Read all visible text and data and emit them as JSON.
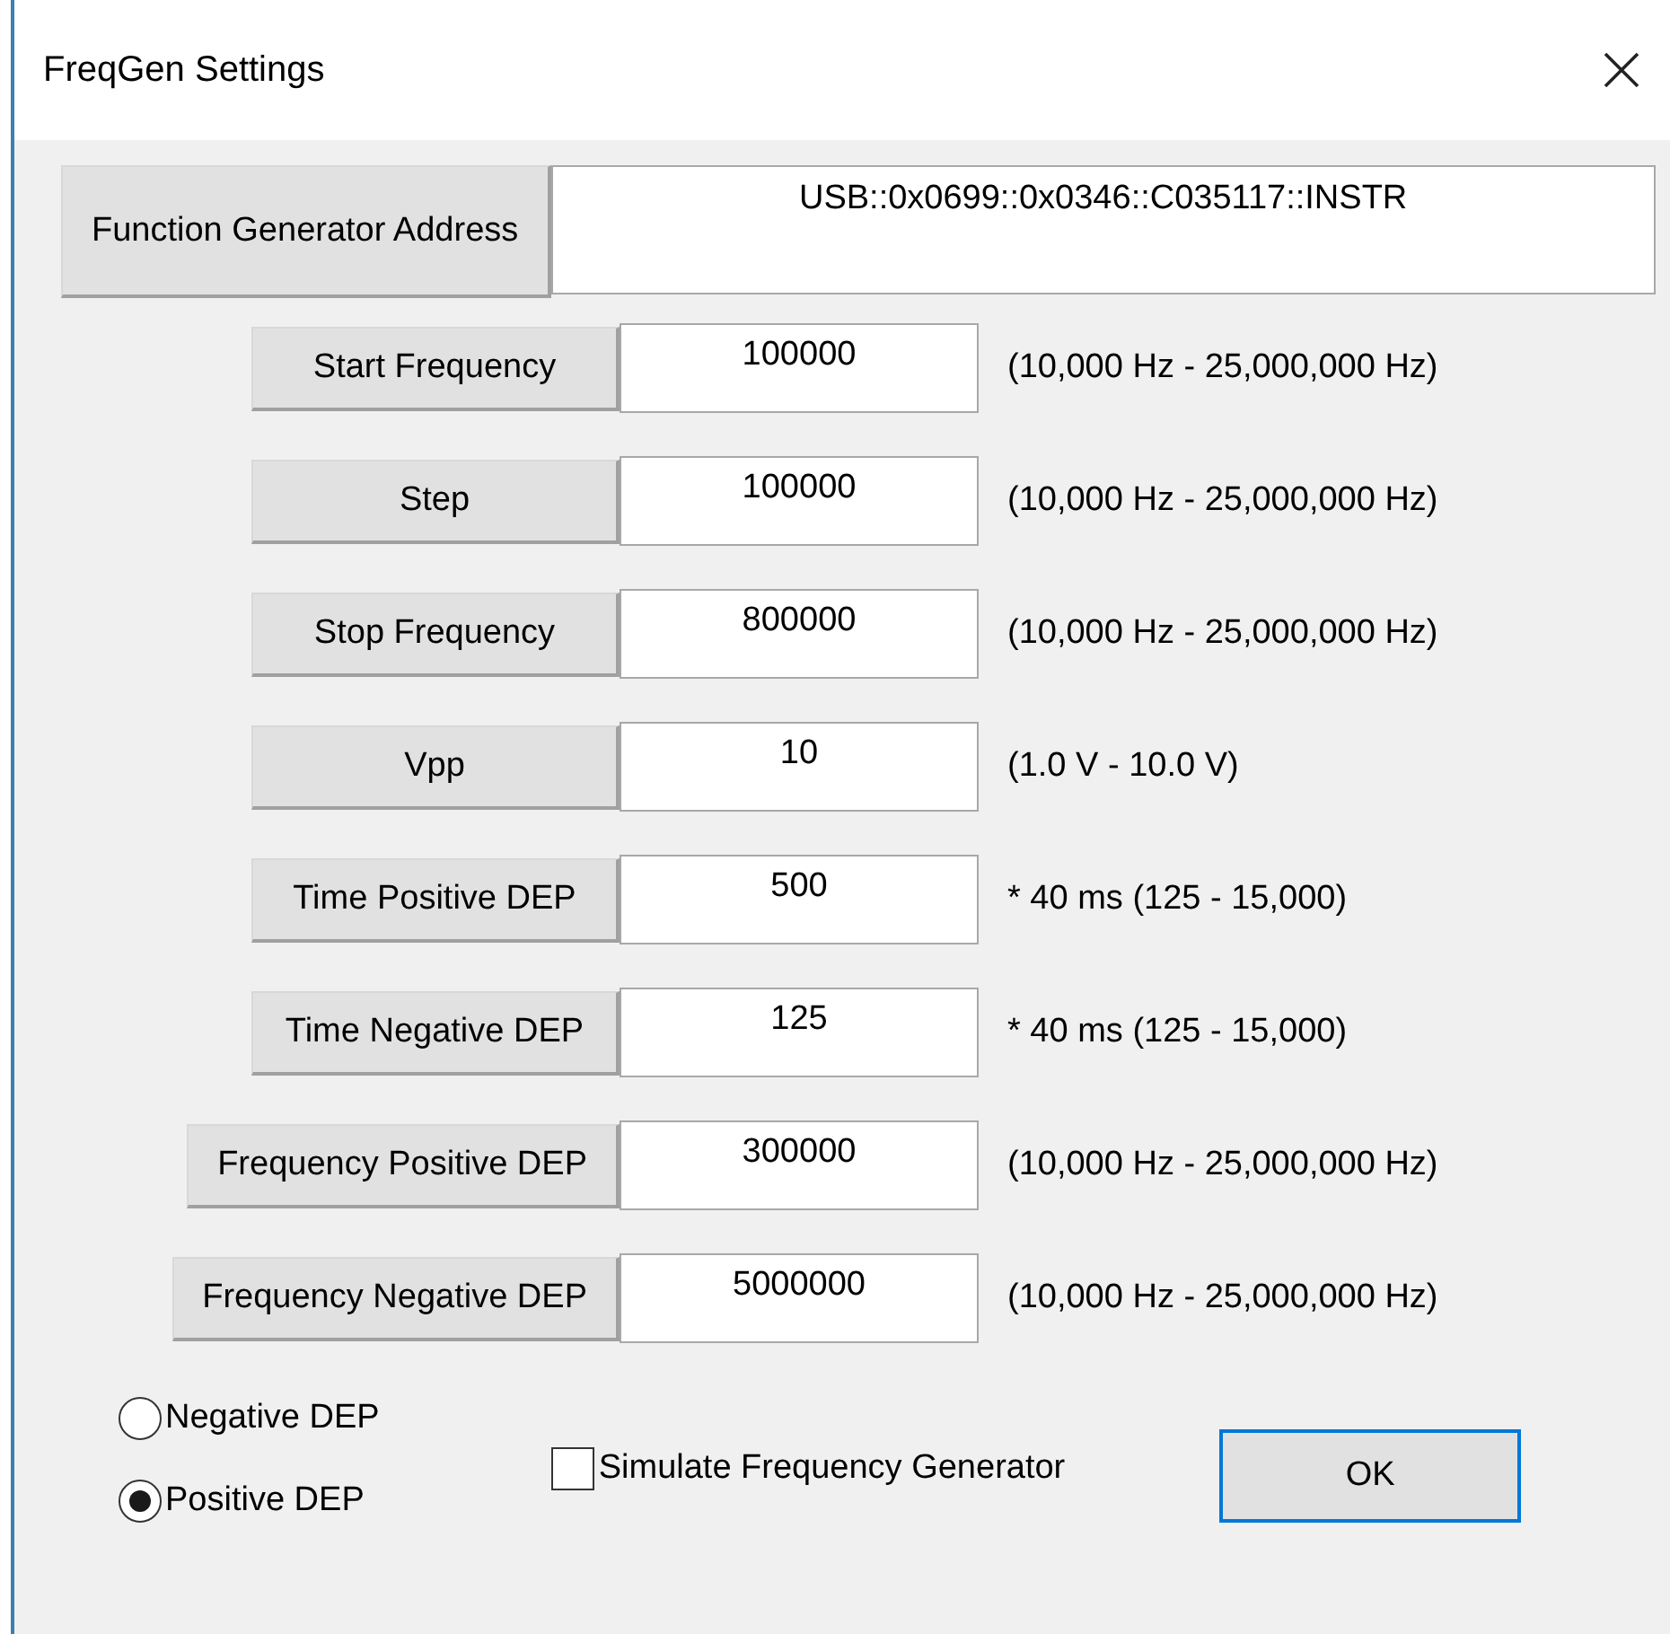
{
  "window": {
    "title": "FreqGen Settings"
  },
  "address": {
    "label": "Function Generator Address",
    "value": "USB::0x0699::0x0346::C035117::INSTR"
  },
  "parameters": [
    {
      "label": "Start Frequency",
      "value": "100000",
      "range": "(10,000 Hz - 25,000,000 Hz)"
    },
    {
      "label": "Step",
      "value": "100000",
      "range": "(10,000 Hz - 25,000,000 Hz)"
    },
    {
      "label": "Stop Frequency",
      "value": "800000",
      "range": "(10,000 Hz - 25,000,000 Hz)"
    },
    {
      "label": "Vpp",
      "value": "10",
      "range": "(1.0 V - 10.0 V)"
    },
    {
      "label": "Time Positive DEP",
      "value": "500",
      "range": "* 40 ms (125 - 15,000)"
    },
    {
      "label": "Time Negative DEP",
      "value": "125",
      "range": "* 40 ms (125 - 15,000)"
    },
    {
      "label": "Frequency Positive DEP",
      "value": "300000",
      "range": "(10,000 Hz - 25,000,000 Hz)"
    },
    {
      "label": "Frequency Negative DEP",
      "value": "5000000",
      "range": "(10,000 Hz - 25,000,000 Hz)"
    }
  ],
  "dep_mode": [
    {
      "label": "Negative DEP",
      "selected": false
    },
    {
      "label": "Positive DEP",
      "selected": true
    }
  ],
  "simulate": {
    "label": "Simulate Frequency Generator",
    "checked": false
  },
  "buttons": [
    {
      "label": "OK",
      "default": true
    }
  ]
}
